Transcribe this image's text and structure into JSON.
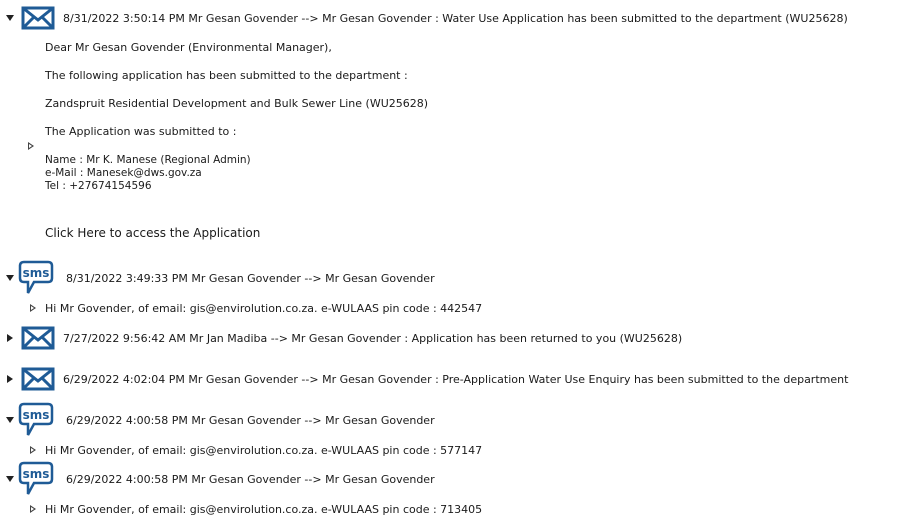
{
  "messages": [
    {
      "type": "email",
      "header": "8/31/2022 3:50:14 PM Mr Gesan Govender --> Mr Gesan Govender : Water Use Application has been submitted to the department (WU25628)",
      "body": {
        "greeting": "Dear Mr Gesan Govender (Environmental Manager),",
        "line1": "The following application has been submitted to the department :",
        "line2": "Zandspruit Residential Development and Bulk Sewer Line (WU25628)",
        "line3": "The Application was submitted to :",
        "contact_name": "Name : Mr K. Manese (Regional Admin)",
        "contact_email": "e-Mail : Manesek@dws.gov.za",
        "contact_tel": "Tel : +27674154596",
        "link_text": "Click Here to access the Application"
      }
    },
    {
      "type": "sms",
      "icon_text": "sms",
      "header": "8/31/2022 3:49:33 PM Mr Gesan Govender --> Mr Gesan Govender",
      "body": "Hi Mr Govender, of email: gis@envirolution.co.za. e-WULAAS pin code : 442547"
    },
    {
      "type": "email",
      "header": "7/27/2022 9:56:42 AM Mr Jan Madiba --> Mr Gesan Govender : Application has been returned to you (WU25628)"
    },
    {
      "type": "email",
      "header": "6/29/2022 4:02:04 PM Mr Gesan Govender --> Mr Gesan Govender : Pre-Application Water Use Enquiry has been submitted to the department"
    },
    {
      "type": "sms",
      "icon_text": "sms",
      "header": "6/29/2022 4:00:58 PM Mr Gesan Govender --> Mr Gesan Govender",
      "body": "Hi Mr Govender, of email: gis@envirolution.co.za. e-WULAAS pin code : 577147"
    },
    {
      "type": "sms",
      "icon_text": "sms",
      "header": "6/29/2022 4:00:58 PM Mr Gesan Govender --> Mr Gesan Govender",
      "body": "Hi Mr Govender, of email: gis@envirolution.co.za. e-WULAAS pin code : 713405"
    }
  ],
  "colors": {
    "icon_blue": "#1f5b96",
    "text": "#1a1a1a"
  },
  "icons": {
    "email": "envelope-icon",
    "sms": "sms-bubble-icon"
  }
}
